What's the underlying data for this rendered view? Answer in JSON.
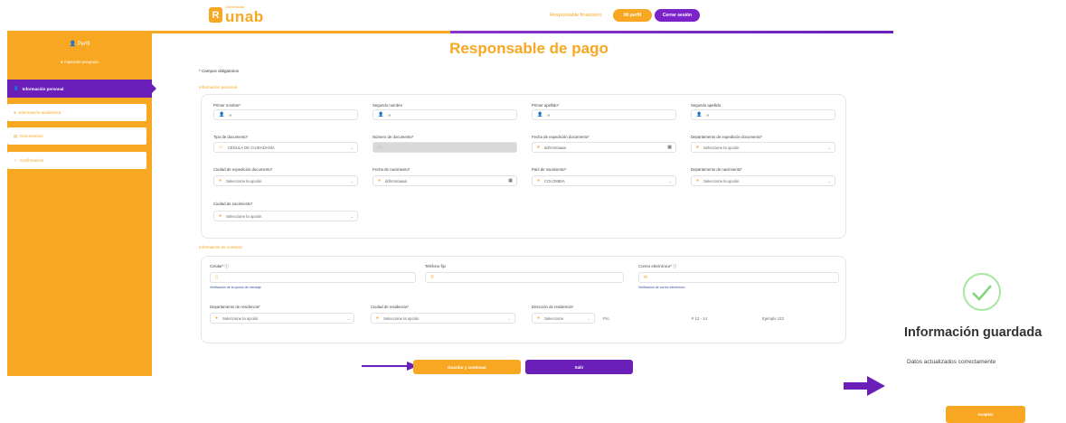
{
  "header": {
    "logo_small": "Universidad",
    "logo_text": "unab",
    "user_text": "Responsable financiero",
    "profile_btn": "Mi perfil",
    "logout_btn": "Cerrar sesión"
  },
  "sidebar": {
    "user_name": "Perfil",
    "user_sub": "Aspirante pregrado",
    "active_item": "Información personal",
    "items": [
      "Información académica",
      "Documentos",
      "Confirmación"
    ]
  },
  "page_title": "Responsable de pago",
  "required_note": "* Campos obligatorios",
  "personal_section": "Información personal",
  "contact_section": "Información de contacto",
  "fields": {
    "first_name": {
      "label": "Primer nombre*",
      "value": "A"
    },
    "second_name": {
      "label": "Segundo nombre",
      "value": "A"
    },
    "first_surname": {
      "label": "Primer apellido*",
      "value": "A"
    },
    "second_surname": {
      "label": "Segundo apellido",
      "value": "A"
    },
    "doc_type": {
      "label": "Tipo de documento*",
      "value": "CÉDULA DE CIUDADANÍA"
    },
    "doc_number": {
      "label": "Número de documento*",
      "value": ""
    },
    "doc_date": {
      "label": "Fecha de expedición documento*",
      "value": "dd/mm/aaaa"
    },
    "doc_dept": {
      "label": "Departamento de expedición documento*",
      "value": "Seleccione la opción"
    },
    "doc_city": {
      "label": "Ciudad de expedición documento*",
      "value": "Seleccione la opción"
    },
    "birth_date": {
      "label": "Fecha de nacimiento*",
      "value": "dd/mm/aaaa"
    },
    "birth_country": {
      "label": "País de nacimiento*",
      "value": "COLOMBIA"
    },
    "birth_dept": {
      "label": "Departamento de nacimiento*",
      "value": "Seleccione la opción"
    },
    "birth_city": {
      "label": "Ciudad de nacimiento*",
      "value": "Seleccione la opción"
    },
    "mobile": {
      "label": "Celular* ⓘ",
      "value": "",
      "help": "Verificación de la opción de mensaje"
    },
    "phone": {
      "label": "Teléfono fijo",
      "value": ""
    },
    "email": {
      "label": "Correo electrónico* ⓘ",
      "value": "",
      "help": "Verificación de correo electrónico"
    },
    "res_dept": {
      "label": "Departamento de residencia*",
      "value": "Seleccione la opción"
    },
    "res_city": {
      "label": "Ciudad de residencia*",
      "value": "Seleccione la opción"
    },
    "address": {
      "label": "Dirección de residencia*",
      "value": "Seleccione",
      "part2": "Pro",
      "part3": "# 12 - 14",
      "part4": "Ejemplo 123"
    }
  },
  "buttons": {
    "save": "Guardar y continuar",
    "exit": "Salir"
  },
  "modal": {
    "title": "Información guardada",
    "subtitle": "Datos actualizados correctamente",
    "accept": "Aceptar"
  },
  "colors": {
    "orange": "#f7a721",
    "purple": "#6a1fb8"
  }
}
